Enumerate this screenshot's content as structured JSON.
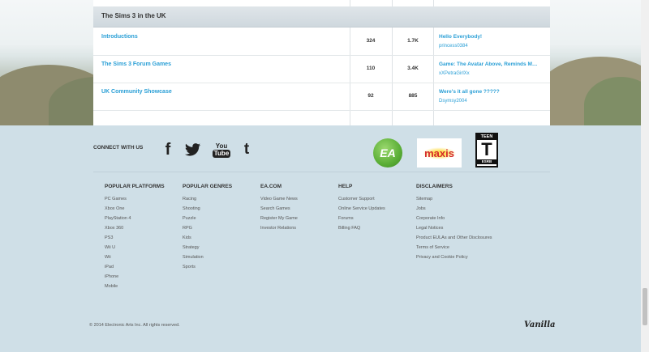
{
  "category": {
    "title": "The Sims 3 in the UK",
    "rows": [
      {
        "title": "Introductions",
        "discussions": "324",
        "comments": "1.7K",
        "last_title": "Hello Everybody!",
        "last_user": "princess0384"
      },
      {
        "title": "The Sims 3 Forum Games",
        "discussions": "110",
        "comments": "3.4K",
        "last_title": "Game: The Avatar Above, Reminds M…",
        "last_user": "xXPetraGirlXx"
      },
      {
        "title": "UK Community Showcase",
        "discussions": "92",
        "comments": "885",
        "last_title": "Were's it all gone ?????",
        "last_user": "Dsymsy2004"
      }
    ]
  },
  "footer": {
    "connect_label": "CONNECT WITH US",
    "social": {
      "facebook": "f",
      "youtube_you": "You",
      "youtube_tube": "Tube",
      "tumblr": "t"
    },
    "logos": {
      "ea": "EA",
      "maxis": "maxis",
      "rating_top": "TEEN",
      "rating_letter": "T",
      "rating_bottom": "ESRB"
    },
    "columns": [
      {
        "heading": "POPULAR PLATFORMS",
        "items": [
          "PC Games",
          "Xbox One",
          "PlayStation 4",
          "Xbox 360",
          "PS3",
          "Wii U",
          "Wii",
          "iPad",
          "iPhone",
          "Mobile"
        ]
      },
      {
        "heading": "POPULAR GENRES",
        "items": [
          "Racing",
          "Shooting",
          "Puzzle",
          "RPG",
          "Kids",
          "Strategy",
          "Simulation",
          "Sports"
        ]
      },
      {
        "heading": "EA.COM",
        "items": [
          "Video Game News",
          "Search Games",
          "Register My Game",
          "Investor Relations"
        ]
      },
      {
        "heading": "HELP",
        "items": [
          "Customer Support",
          "Online Service Updates",
          "Forums",
          "Billing FAQ"
        ]
      },
      {
        "heading": "DISCLAIMERS",
        "items": [
          "Sitemap",
          "Jobs",
          "Corporate Info",
          "Legal Notices",
          "Product EULAs and Other Disclosures",
          "Terms of Service",
          "Privacy and Cookie Policy"
        ]
      }
    ],
    "copyright": "© 2014 Electronic Arts Inc. All rights reserved.",
    "vanilla": "Vanilla"
  },
  "colors": {
    "link": "#2a9fd6",
    "footer_bg": "#cfdfe7",
    "ea_green": "#6cc04a",
    "maxis_red": "#d42b2b"
  }
}
